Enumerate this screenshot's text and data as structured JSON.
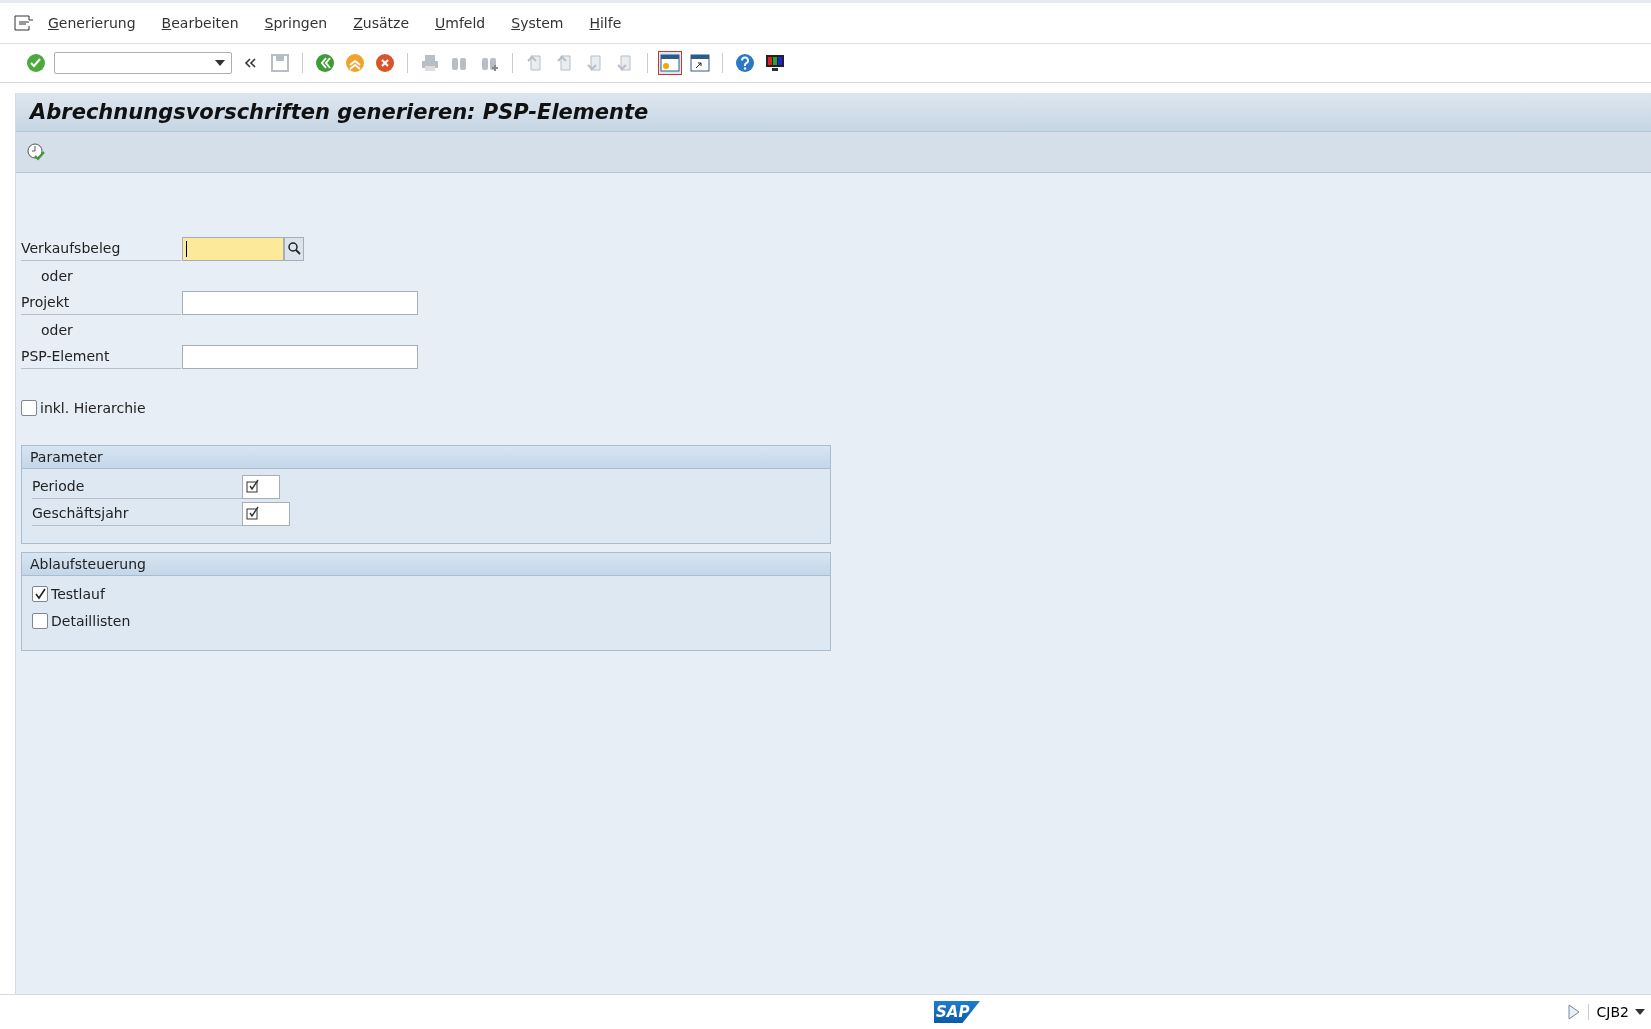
{
  "menu_bar": {
    "items": [
      {
        "label": "Generierung"
      },
      {
        "label": "Bearbeiten"
      },
      {
        "label": "Springen"
      },
      {
        "label": "Zusätze"
      },
      {
        "label": "Umfeld"
      },
      {
        "label": "System"
      },
      {
        "label": "Hilfe"
      }
    ]
  },
  "toolbar": {
    "groups": [
      [
        {
          "kind": "enter",
          "disabled": false
        },
        {
          "kind": "command-field",
          "disabled": false
        },
        {
          "kind": "collapse",
          "disabled": false
        },
        {
          "kind": "save",
          "disabled": true
        }
      ],
      [
        {
          "kind": "back",
          "disabled": false
        },
        {
          "kind": "exit",
          "disabled": false
        },
        {
          "kind": "cancel",
          "disabled": false
        }
      ],
      [
        {
          "kind": "print",
          "disabled": true
        },
        {
          "kind": "find",
          "disabled": true
        },
        {
          "kind": "find-next",
          "disabled": true
        }
      ],
      [
        {
          "kind": "first-page",
          "disabled": true
        },
        {
          "kind": "previous-page",
          "disabled": true
        },
        {
          "kind": "next-page",
          "disabled": true
        },
        {
          "kind": "last-page",
          "disabled": true
        }
      ],
      [
        {
          "kind": "new-session",
          "disabled": false,
          "selected": true
        },
        {
          "kind": "shortcut",
          "disabled": false,
          "selected": false
        }
      ],
      [
        {
          "kind": "help",
          "disabled": false
        },
        {
          "kind": "layout",
          "disabled": false
        }
      ]
    ]
  },
  "screen": {
    "title": "Abrechnungsvorschriften generieren: PSP-Elemente"
  },
  "selection": {
    "rows": [
      {
        "kind": "field",
        "label": "Verkaufsbeleg",
        "focused": true,
        "search_help": true
      },
      {
        "kind": "note",
        "label": "oder"
      },
      {
        "kind": "field",
        "label": "Projekt",
        "focused": false,
        "search_help": false
      },
      {
        "kind": "note",
        "label": "oder"
      },
      {
        "kind": "field",
        "label": "PSP-Element",
        "focused": false,
        "search_help": false
      }
    ],
    "hierarchy": {
      "label": "inkl. Hierarchie",
      "checked": false
    }
  },
  "groups": [
    {
      "title": "Parameter",
      "rows": [
        {
          "kind": "param",
          "label": "Periode",
          "required": true
        },
        {
          "kind": "param",
          "label": "Geschäftsjahr",
          "required": true
        }
      ]
    },
    {
      "title": "Ablaufsteuerung",
      "rows": [
        {
          "kind": "checkbox",
          "label": "Testlauf",
          "checked": true
        },
        {
          "kind": "checkbox",
          "label": "Detaillisten",
          "checked": false
        }
      ]
    }
  ],
  "status_bar": {
    "logo": "SAP",
    "transaction": "CJB2"
  }
}
